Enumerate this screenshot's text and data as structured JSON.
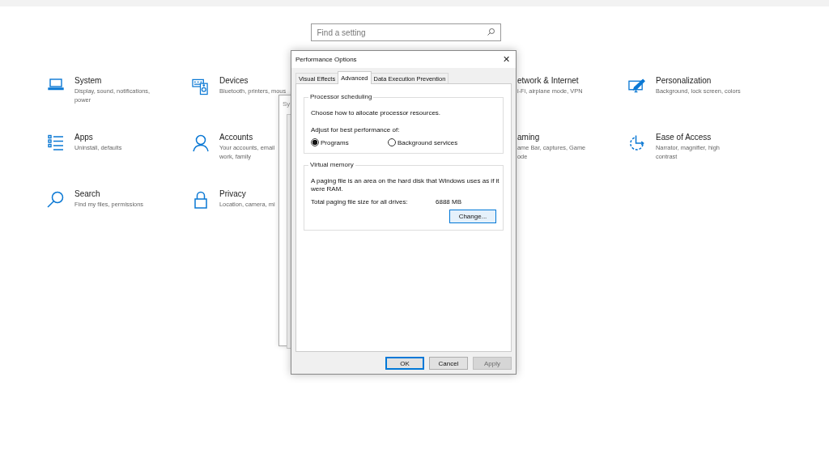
{
  "search": {
    "placeholder": "Find a setting"
  },
  "categories": [
    {
      "kind": "full",
      "title": "System",
      "description_lines": [
        "Display, sound, notifications,",
        "power"
      ]
    },
    {
      "kind": "full",
      "title": "Devices",
      "description_lines": [
        "Bluetooth, printers, mous"
      ]
    },
    {
      "kind": "clipped",
      "title": "etwork & Internet",
      "description_lines": [
        "i-Fi, airplane mode, VPN"
      ]
    },
    {
      "kind": "full",
      "title": "Personalization",
      "description_lines": [
        "Background, lock screen, colors"
      ]
    },
    {
      "kind": "full",
      "title": "Apps",
      "description_lines": [
        "Uninstall, defaults"
      ]
    },
    {
      "kind": "full",
      "title": "Accounts",
      "description_lines": [
        "Your accounts, email",
        "work, family"
      ]
    },
    {
      "kind": "clipped",
      "title": "aming",
      "description_lines": [
        "ame Bar, captures, Game",
        "ode"
      ]
    },
    {
      "kind": "full",
      "title": "Ease of Access",
      "description_lines": [
        "Narrator, magnifier, high",
        "contrast"
      ]
    },
    {
      "kind": "full",
      "title": "Search",
      "description_lines": [
        "Find my files, permissions"
      ]
    },
    {
      "kind": "full",
      "title": "Privacy",
      "description_lines": [
        "Location, camera, mi"
      ]
    }
  ],
  "behind_window": {
    "title": "Sy"
  },
  "dialog": {
    "title": "Performance Options",
    "close": "✕",
    "tabs": [
      {
        "label": "Visual Effects",
        "selected": false
      },
      {
        "label": "Advanced",
        "selected": true
      },
      {
        "label": "Data Execution Prevention",
        "selected": false
      }
    ],
    "processor_scheduling": {
      "legend": "Processor scheduling",
      "text": "Choose how to allocate processor resources.",
      "adjust_label": "Adjust for best performance of:",
      "options": [
        {
          "label": "Programs",
          "selected": true
        },
        {
          "label": "Background services",
          "selected": false
        }
      ]
    },
    "virtual_memory": {
      "legend": "Virtual memory",
      "text": "A paging file is an area on the hard disk that Windows uses as if it were RAM.",
      "total_label": "Total paging file size for all drives:",
      "total_value": "6888 MB",
      "change_button": "Change..."
    },
    "buttons": [
      {
        "label": "OK",
        "default": true,
        "disabled": false
      },
      {
        "label": "Cancel",
        "default": false,
        "disabled": false
      },
      {
        "label": "Apply",
        "default": false,
        "disabled": true
      }
    ]
  }
}
